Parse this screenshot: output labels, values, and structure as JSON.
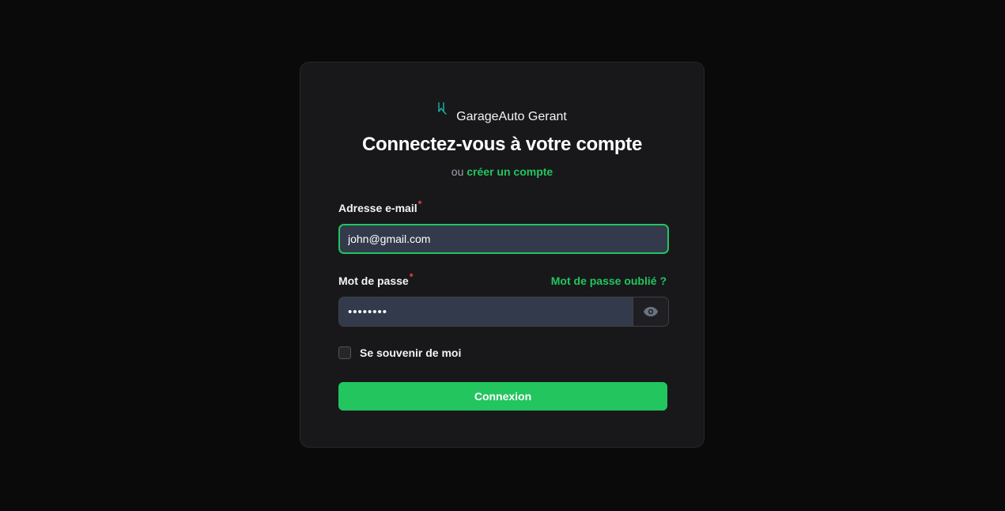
{
  "brand": {
    "name": "GarageAuto Gerant",
    "logo_icon": "brand-logo-icon",
    "logo_color": "#14b8a6"
  },
  "login": {
    "title": "Connectez-vous à votre compte",
    "or_text": "ou",
    "create_account_link": "créer un compte"
  },
  "form": {
    "email": {
      "label": "Adresse e-mail",
      "required_marker": "*",
      "value": "john@gmail.com"
    },
    "password": {
      "label": "Mot de passe",
      "required_marker": "*",
      "value": "••••••••",
      "forgot_link": "Mot de passe oublié ?",
      "toggle_icon": "eye-icon"
    },
    "remember": {
      "label": "Se souvenir de moi",
      "checked": false
    },
    "submit_label": "Connexion"
  },
  "colors": {
    "accent": "#22c55e",
    "required": "#ef4444",
    "card_bg": "#18181b",
    "page_bg": "#0a0a0b",
    "input_bg": "#333a4b"
  }
}
